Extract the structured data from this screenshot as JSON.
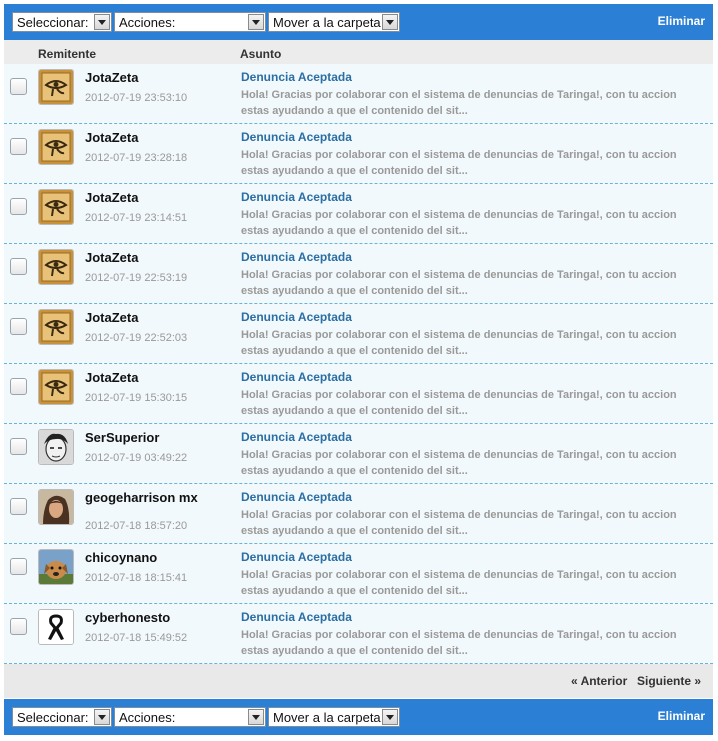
{
  "toolbar": {
    "select_label": "Seleccionar:",
    "actions_label": "Acciones:",
    "move_label": "Mover a la carpeta",
    "delete_label": "Eliminar"
  },
  "columns": {
    "sender": "Remitente",
    "subject": "Asunto"
  },
  "messages": [
    {
      "sender": "JotaZeta",
      "date": "2012-07-19 23:53:10",
      "subject": "Denuncia Aceptada",
      "preview": "Hola! Gracias por colaborar con el sistema de denuncias de Taringa!, con tu accion estas ayudando a que el contenido del sit...",
      "avatar": "eye-of-horus"
    },
    {
      "sender": "JotaZeta",
      "date": "2012-07-19 23:28:18",
      "subject": "Denuncia Aceptada",
      "preview": "Hola! Gracias por colaborar con el sistema de denuncias de Taringa!, con tu accion estas ayudando a que el contenido del sit...",
      "avatar": "eye-of-horus"
    },
    {
      "sender": "JotaZeta",
      "date": "2012-07-19 23:14:51",
      "subject": "Denuncia Aceptada",
      "preview": "Hola! Gracias por colaborar con el sistema de denuncias de Taringa!, con tu accion estas ayudando a que el contenido del sit...",
      "avatar": "eye-of-horus"
    },
    {
      "sender": "JotaZeta",
      "date": "2012-07-19 22:53:19",
      "subject": "Denuncia Aceptada",
      "preview": "Hola! Gracias por colaborar con el sistema de denuncias de Taringa!, con tu accion estas ayudando a que el contenido del sit...",
      "avatar": "eye-of-horus"
    },
    {
      "sender": "JotaZeta",
      "date": "2012-07-19 22:52:03",
      "subject": "Denuncia Aceptada",
      "preview": "Hola! Gracias por colaborar con el sistema de denuncias de Taringa!, con tu accion estas ayudando a que el contenido del sit...",
      "avatar": "eye-of-horus"
    },
    {
      "sender": "JotaZeta",
      "date": "2012-07-19 15:30:15",
      "subject": "Denuncia Aceptada",
      "preview": "Hola! Gracias por colaborar con el sistema de denuncias de Taringa!, con tu accion estas ayudando a que el contenido del sit...",
      "avatar": "eye-of-horus"
    },
    {
      "sender": "SerSuperior",
      "date": "2012-07-19 03:49:22",
      "subject": "Denuncia Aceptada",
      "preview": "Hola! Gracias por colaborar con el sistema de denuncias de Taringa!, con tu accion estas ayudando a que el contenido del sit...",
      "avatar": "sketch-face"
    },
    {
      "sender": "geogeharrison mx",
      "date": "2012-07-18 18:57:20",
      "subject": "Denuncia Aceptada",
      "preview": "Hola! Gracias por colaborar con el sistema de denuncias de Taringa!, con tu accion estas ayudando a que el contenido del sit...",
      "avatar": "portrait"
    },
    {
      "sender": "chicoynano",
      "date": "2012-07-18 18:15:41",
      "subject": "Denuncia Aceptada",
      "preview": "Hola! Gracias por colaborar con el sistema de denuncias de Taringa!, con tu accion estas ayudando a que el contenido del sit...",
      "avatar": "dog"
    },
    {
      "sender": "cyberhonesto",
      "date": "2012-07-18 15:49:52",
      "subject": "Denuncia Aceptada",
      "preview": "Hola! Gracias por colaborar con el sistema de denuncias de Taringa!, con tu accion estas ayudando a que el contenido del sit...",
      "avatar": "black-ribbon"
    }
  ],
  "pager": {
    "prev": "« Anterior",
    "next": "Siguiente »"
  },
  "colors": {
    "toolbar_bg": "#2b7fd4",
    "link": "#2b6ea3",
    "row_bg": "#f2f9fc",
    "divider": "#6ab3d6"
  }
}
